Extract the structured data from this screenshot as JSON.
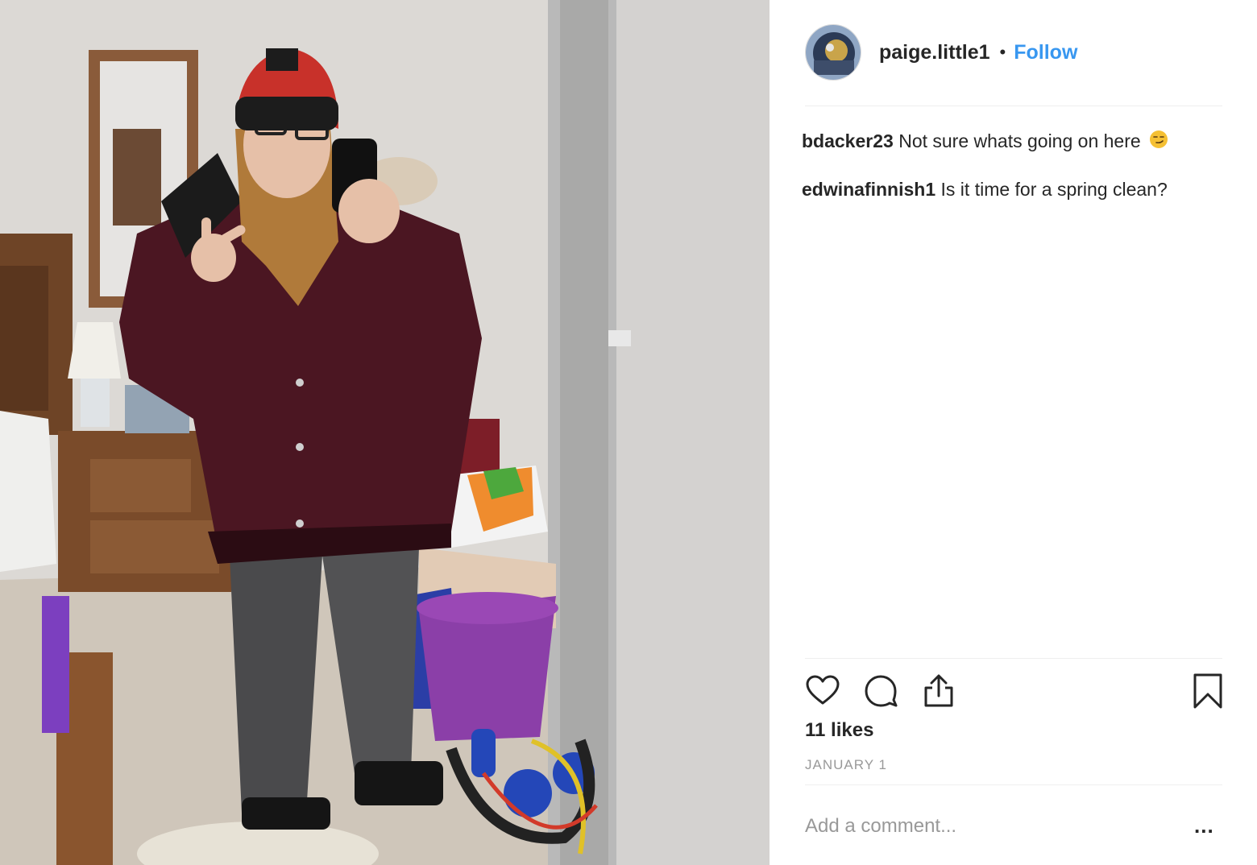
{
  "post": {
    "username": "paige.little1",
    "separator": "•",
    "follow_label": "Follow",
    "likes": "11 likes",
    "date": "JANUARY 1",
    "comment_placeholder": "Add a comment...",
    "more_label": "..."
  },
  "comments": [
    {
      "author": "bdacker23",
      "text": "Not sure whats going on here",
      "emoji": "smirking-face-emoji"
    },
    {
      "author": "edwinafinnish1",
      "text": "Is it time for a spring clean?"
    }
  ],
  "icons": {
    "like": "heart-icon",
    "comment": "comment-bubble-icon",
    "share": "share-icon",
    "save": "bookmark-icon"
  },
  "colors": {
    "link": "#3897f0",
    "text": "#262626",
    "muted": "#999999",
    "divider": "#efefef"
  }
}
